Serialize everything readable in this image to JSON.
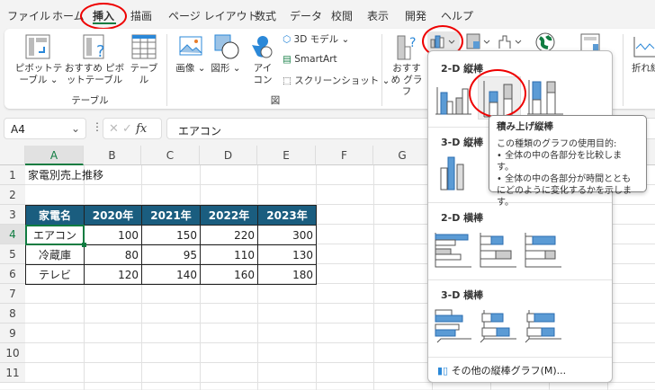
{
  "menu": {
    "tabs": [
      "ファイル",
      "ホーム",
      "挿入",
      "描画",
      "ページ レイアウト",
      "数式",
      "データ",
      "校閲",
      "表示",
      "開発",
      "ヘルプ"
    ]
  },
  "ribbon": {
    "pivot": "ピボットテーブル ⌄",
    "recommended_pivot": "おすすめ ピボットテーブル",
    "table": "テーブル",
    "group_table": "テーブル",
    "image": "画像 ⌄",
    "shapes": "図形 ⌄",
    "icons": "アイコン",
    "model3d": "3D モデル ⌄",
    "smartart": "SmartArt",
    "screenshot": "スクリーンショット ⌄",
    "group_fig": "図",
    "recommended_chart": "おすすめ グラフ",
    "line": "折れ線"
  },
  "formula": {
    "namebox": "A4",
    "value": "エアコン",
    "fx": "fx"
  },
  "columns": [
    "A",
    "B",
    "C",
    "D",
    "E",
    "F",
    "G"
  ],
  "rows": [
    "1",
    "2",
    "3",
    "4",
    "5",
    "6",
    "7",
    "8",
    "9",
    "10",
    "11"
  ],
  "sheet": {
    "title": "家電別売上推移",
    "headers": [
      "家電名",
      "2020年",
      "2021年",
      "2022年",
      "2023年"
    ],
    "data": [
      [
        "エアコン",
        "100",
        "150",
        "220",
        "300"
      ],
      [
        "冷蔵庫",
        "80",
        "95",
        "110",
        "130"
      ],
      [
        "テレビ",
        "120",
        "140",
        "160",
        "180"
      ]
    ]
  },
  "dropdown": {
    "sec1": "2-D 縦棒",
    "sec2": "3-D 縦棒",
    "sec3": "2-D 横棒",
    "sec4": "3-D 横棒",
    "more": "その他の縦棒グラフ(M)..."
  },
  "tooltip": {
    "title": "積み上げ縦棒",
    "line1": "この種類のグラフの使用目的:",
    "line2": "• 全体の中の各部分を比較します。",
    "line3": "• 全体の中の各部分が時間とともにどのように変化するかを示します。"
  },
  "colors": {
    "header": "#1a5d7f",
    "accent": "#5b9bd5",
    "highlight": "#e00000"
  }
}
